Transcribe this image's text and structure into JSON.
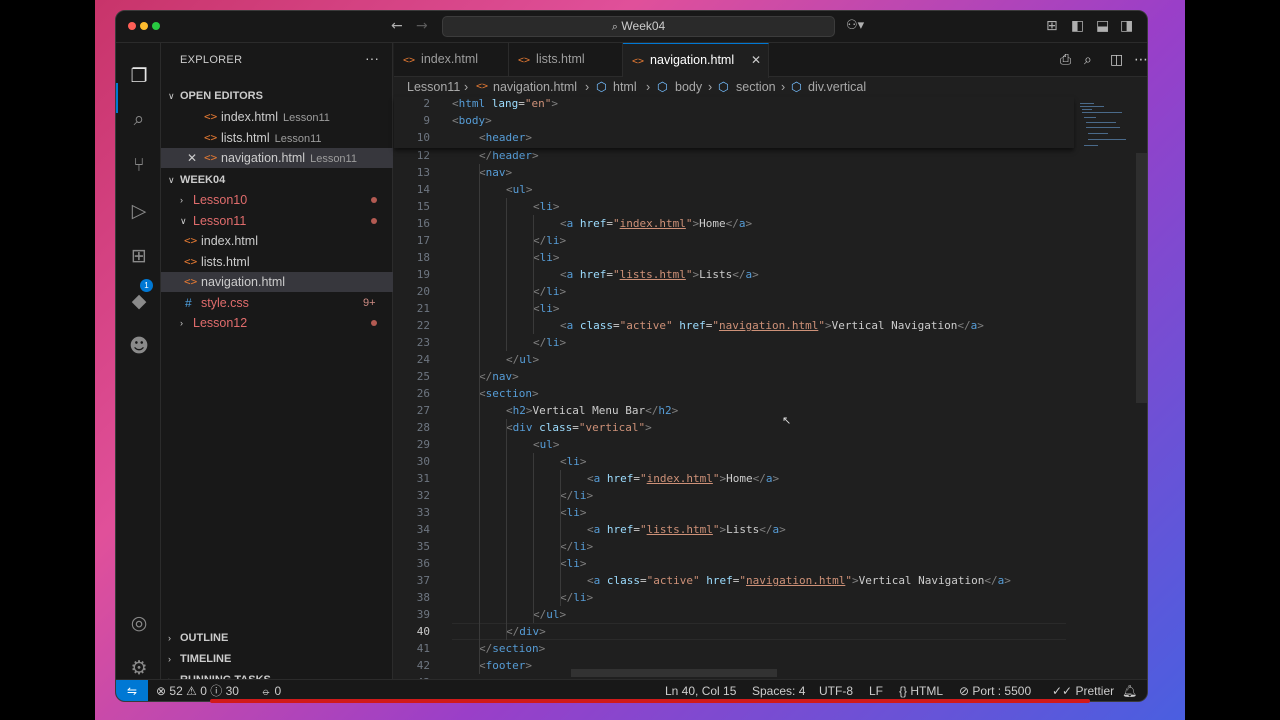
{
  "window": {
    "search_text": "Week04"
  },
  "activity_bar": {
    "extensions_badge": "1",
    "items": [
      "files-icon",
      "search-icon",
      "source-control-icon",
      "run-debug-icon",
      "extensions-icon",
      "remote-icon",
      "copilot-icon",
      "account-icon",
      "settings-gear-icon"
    ]
  },
  "sidebar": {
    "title": "EXPLORER",
    "more": "···",
    "open_editors_label": "OPEN EDITORS",
    "open_editors": [
      {
        "name": "index.html",
        "desc": "Lesson11"
      },
      {
        "name": "lists.html",
        "desc": "Lesson11"
      },
      {
        "name": "navigation.html",
        "desc": "Lesson11"
      }
    ],
    "folder_label": "WEEK04",
    "tree": [
      {
        "name": "Lesson10",
        "type": "folder"
      },
      {
        "name": "Lesson11",
        "type": "folder"
      },
      {
        "name": "index.html",
        "type": "html"
      },
      {
        "name": "lists.html",
        "type": "html"
      },
      {
        "name": "navigation.html",
        "type": "html"
      },
      {
        "name": "style.css",
        "type": "css",
        "count": "9+"
      },
      {
        "name": "Lesson12",
        "type": "folder"
      }
    ],
    "outline_label": "OUTLINE",
    "timeline_label": "TIMELINE",
    "running_tasks_label": "RUNNING TASKS"
  },
  "tabs": [
    {
      "label": "index.html"
    },
    {
      "label": "lists.html"
    },
    {
      "label": "navigation.html"
    }
  ],
  "breadcrumb": [
    "Lesson11",
    "navigation.html",
    "html",
    "body",
    "section",
    "div.vertical"
  ],
  "code": {
    "sticky": [
      {
        "n": "2",
        "text": "<html lang=\"en\">"
      },
      {
        "n": "9",
        "text": "<body>"
      },
      {
        "n": "10",
        "text": "<header>"
      }
    ],
    "lines": [
      {
        "n": "12",
        "text": "</header>"
      },
      {
        "n": "13",
        "text": "<nav>"
      },
      {
        "n": "14",
        "text": "<ul>"
      },
      {
        "n": "15",
        "text": "<li>"
      },
      {
        "n": "16",
        "text": "<a href=\"index.html\">Home</a>"
      },
      {
        "n": "17",
        "text": "</li>"
      },
      {
        "n": "18",
        "text": "<li>"
      },
      {
        "n": "19",
        "text": "<a href=\"lists.html\">Lists</a>"
      },
      {
        "n": "20",
        "text": "</li>"
      },
      {
        "n": "21",
        "text": "<li>"
      },
      {
        "n": "22",
        "text": "<a class=\"active\" href=\"navigation.html\">Vertical Navigation</a>"
      },
      {
        "n": "23",
        "text": "</li>"
      },
      {
        "n": "24",
        "text": "</ul>"
      },
      {
        "n": "25",
        "text": "</nav>"
      },
      {
        "n": "26",
        "text": "<section>"
      },
      {
        "n": "27",
        "text": "<h2>Vertical Menu Bar</h2>"
      },
      {
        "n": "28",
        "text": "<div class=\"vertical\">"
      },
      {
        "n": "29",
        "text": "<ul>"
      },
      {
        "n": "30",
        "text": "<li>"
      },
      {
        "n": "31",
        "text": "<a href=\"index.html\">Home</a>"
      },
      {
        "n": "32",
        "text": "</li>"
      },
      {
        "n": "33",
        "text": "<li>"
      },
      {
        "n": "34",
        "text": "<a href=\"lists.html\">Lists</a>"
      },
      {
        "n": "35",
        "text": "</li>"
      },
      {
        "n": "36",
        "text": "<li>"
      },
      {
        "n": "37",
        "text": "<a class=\"active\" href=\"navigation.html\">Vertical Navigation</a>"
      },
      {
        "n": "38",
        "text": "</li>"
      },
      {
        "n": "39",
        "text": "</ul>"
      },
      {
        "n": "40",
        "text": "</div>"
      },
      {
        "n": "41",
        "text": "</section>"
      },
      {
        "n": "42",
        "text": "<footer>"
      },
      {
        "n": "43",
        "text": "<p>"
      }
    ],
    "current_line": "40"
  },
  "status": {
    "errors": "52",
    "warnings": "0",
    "infos": "30",
    "ports": "0",
    "position": "Ln 40, Col 15",
    "spaces": "Spaces: 4",
    "encoding": "UTF-8",
    "eol": "LF",
    "language": "HTML",
    "port": "Port : 5500",
    "formatter": "Prettier"
  },
  "colors": {
    "accent": "#0078d4",
    "tag": "#569cd6",
    "attr": "#9cdcfe",
    "string": "#ce9178",
    "html_icon": "#e37933",
    "git_modified": "#e06c6c"
  }
}
